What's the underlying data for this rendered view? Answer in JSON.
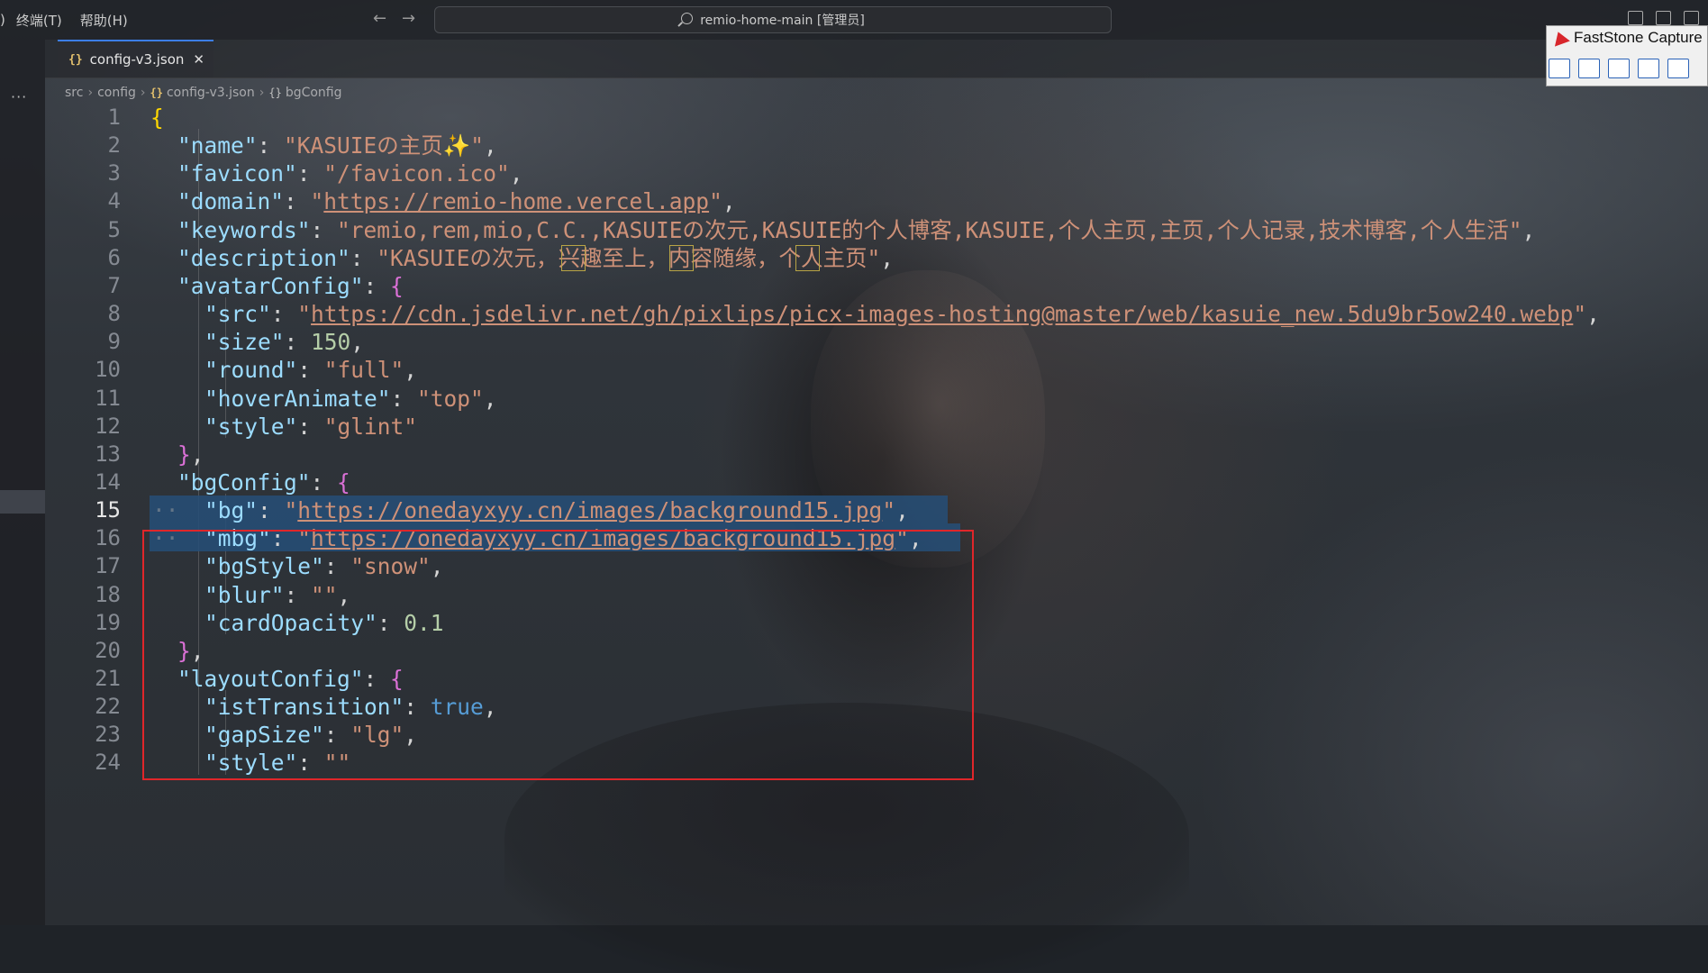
{
  "menu": {
    "fragment": ")",
    "terminal": "终端(T)",
    "help": "帮助(H)"
  },
  "command_center": {
    "title": "remio-home-main [管理员]"
  },
  "activity": {
    "more": "···"
  },
  "tab": {
    "label": "config-v3.json",
    "close": "✕"
  },
  "breadcrumb": {
    "items": [
      "src",
      "config",
      "config-v3.json",
      "bgConfig"
    ]
  },
  "faststone": {
    "title": "FastStone Capture"
  },
  "editor": {
    "active_line": 15,
    "lines": [
      {
        "n": "1",
        "t": [
          [
            "br1",
            "{"
          ]
        ]
      },
      {
        "n": "2",
        "t": [
          [
            "k",
            "\"name\""
          ],
          [
            "p",
            ": "
          ],
          [
            "s",
            "\"KASUIEの主页✨\""
          ],
          [
            "p",
            ","
          ]
        ]
      },
      {
        "n": "3",
        "t": [
          [
            "k",
            "\"favicon\""
          ],
          [
            "p",
            ": "
          ],
          [
            "s",
            "\"/favicon.ico\""
          ],
          [
            "p",
            ","
          ]
        ]
      },
      {
        "n": "4",
        "t": [
          [
            "k",
            "\"domain\""
          ],
          [
            "p",
            ": "
          ],
          [
            "s",
            "\""
          ],
          [
            "s u",
            "https://remio-home.vercel.app"
          ],
          [
            "s",
            "\""
          ],
          [
            "p",
            ","
          ]
        ]
      },
      {
        "n": "5",
        "t": [
          [
            "k",
            "\"keywords\""
          ],
          [
            "p",
            ": "
          ],
          [
            "s",
            "\"remio,rem,mio,C.C.,KASUIEの次元,KASUIE的个人博客,KASUIE,个人主页,主页,个人记录,技术博客,个人生活\""
          ],
          [
            "p",
            ","
          ]
        ]
      },
      {
        "n": "6",
        "t": [
          [
            "k",
            "\"description\""
          ],
          [
            "p",
            ": "
          ],
          [
            "s",
            "\"KASUIEの次元，兴趣至上，内容随缘，个人主页\""
          ],
          [
            "p",
            ","
          ]
        ]
      },
      {
        "n": "7",
        "t": [
          [
            "k",
            "\"avatarConfig\""
          ],
          [
            "p",
            ": "
          ],
          [
            "br2",
            "{"
          ]
        ]
      },
      {
        "n": "8",
        "t": [
          [
            "k",
            "\"src\""
          ],
          [
            "p",
            ": "
          ],
          [
            "s",
            "\""
          ],
          [
            "s u",
            "https://cdn.jsdelivr.net/gh/pixlips/picx-images-hosting@master/web/kasuie_new.5du9br5ow240.webp"
          ],
          [
            "s",
            "\""
          ],
          [
            "p",
            ","
          ]
        ]
      },
      {
        "n": "9",
        "t": [
          [
            "k",
            "\"size\""
          ],
          [
            "p",
            ": "
          ],
          [
            "n",
            "150"
          ],
          [
            "p",
            ","
          ]
        ]
      },
      {
        "n": "10",
        "t": [
          [
            "k",
            "\"round\""
          ],
          [
            "p",
            ": "
          ],
          [
            "s",
            "\"full\""
          ],
          [
            "p",
            ","
          ]
        ]
      },
      {
        "n": "11",
        "t": [
          [
            "k",
            "\"hoverAnimate\""
          ],
          [
            "p",
            ": "
          ],
          [
            "s",
            "\"top\""
          ],
          [
            "p",
            ","
          ]
        ]
      },
      {
        "n": "12",
        "t": [
          [
            "k",
            "\"style\""
          ],
          [
            "p",
            ": "
          ],
          [
            "s",
            "\"glint\""
          ]
        ]
      },
      {
        "n": "13",
        "t": [
          [
            "br2",
            "}"
          ],
          [
            "p",
            ","
          ]
        ]
      },
      {
        "n": "14",
        "t": [
          [
            "k",
            "\"bgConfig\""
          ],
          [
            "p",
            ": "
          ],
          [
            "br2",
            "{"
          ]
        ]
      },
      {
        "n": "15",
        "t": [
          [
            "k",
            "\"bg\""
          ],
          [
            "p",
            ": "
          ],
          [
            "s",
            "\""
          ],
          [
            "s u",
            "https://onedayxyy.cn/images/background15.jpg"
          ],
          [
            "s",
            "\""
          ],
          [
            "p",
            ","
          ]
        ]
      },
      {
        "n": "16",
        "t": [
          [
            "k",
            "\"mbg\""
          ],
          [
            "p",
            ": "
          ],
          [
            "s",
            "\""
          ],
          [
            "s u",
            "https://onedayxyy.cn/images/background15.jpg"
          ],
          [
            "s",
            "\""
          ],
          [
            "p",
            ","
          ]
        ]
      },
      {
        "n": "17",
        "t": [
          [
            "k",
            "\"bgStyle\""
          ],
          [
            "p",
            ": "
          ],
          [
            "s",
            "\"snow\""
          ],
          [
            "p",
            ","
          ]
        ]
      },
      {
        "n": "18",
        "t": [
          [
            "k",
            "\"blur\""
          ],
          [
            "p",
            ": "
          ],
          [
            "s",
            "\"\""
          ],
          [
            "p",
            ","
          ]
        ]
      },
      {
        "n": "19",
        "t": [
          [
            "k",
            "\"cardOpacity\""
          ],
          [
            "p",
            ": "
          ],
          [
            "n",
            "0.1"
          ]
        ]
      },
      {
        "n": "20",
        "t": [
          [
            "br2",
            "}"
          ],
          [
            "p",
            ","
          ]
        ]
      },
      {
        "n": "21",
        "t": [
          [
            "k",
            "\"layoutConfig\""
          ],
          [
            "p",
            ": "
          ],
          [
            "br2",
            "{"
          ]
        ]
      },
      {
        "n": "22",
        "t": [
          [
            "k",
            "\"istTransition\""
          ],
          [
            "p",
            ": "
          ],
          [
            "b",
            "true"
          ],
          [
            "p",
            ","
          ]
        ]
      },
      {
        "n": "23",
        "t": [
          [
            "k",
            "\"gapSize\""
          ],
          [
            "p",
            ": "
          ],
          [
            "s",
            "\"lg\""
          ],
          [
            "p",
            ","
          ]
        ]
      },
      {
        "n": "24",
        "t": [
          [
            "k",
            "\"style\""
          ],
          [
            "p",
            ": "
          ],
          [
            "s",
            "\"\""
          ]
        ]
      }
    ]
  },
  "colors": {
    "key": "#9cdcfe",
    "string": "#ce9178",
    "number": "#b5cea8",
    "boolean": "#569cd6",
    "bracket_level1": "#ffd700",
    "bracket_level2": "#da70d6",
    "selection": "#264f78",
    "annotation_box": "#e0262a",
    "tab_accent": "#3c7ee6"
  }
}
